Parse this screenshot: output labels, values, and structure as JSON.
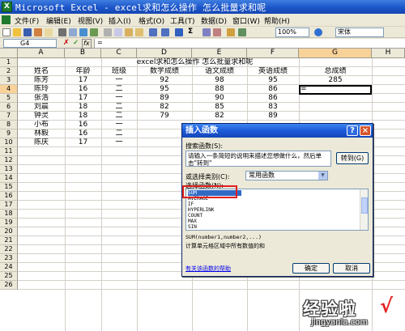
{
  "window": {
    "app_icon": "excel-icon",
    "title": "Microsoft Excel - excel求和怎么操作 怎么批量求和呢"
  },
  "menubar": {
    "items": [
      {
        "label": "文件(F)"
      },
      {
        "label": "编辑(E)"
      },
      {
        "label": "视图(V)"
      },
      {
        "label": "插入(I)"
      },
      {
        "label": "格式(O)"
      },
      {
        "label": "工具(T)"
      },
      {
        "label": "数据(D)"
      },
      {
        "label": "窗口(W)"
      },
      {
        "label": "帮助(H)"
      }
    ]
  },
  "toolbar": {
    "autosum_label": "Σ",
    "zoom": "100%",
    "font": "宋体",
    "icons": [
      "new-icon",
      "open-icon",
      "save-icon",
      "permission-icon",
      "email-icon",
      "print-icon",
      "print-preview-icon",
      "spelling-icon",
      "research-icon",
      "cut-icon",
      "copy-icon",
      "paste-icon",
      "format-painter-icon",
      "undo-icon",
      "redo-icon",
      "hyperlink-icon",
      "autosum-icon",
      "sort-asc-icon",
      "sort-desc-icon",
      "chart-icon",
      "drawing-icon",
      "help-icon"
    ]
  },
  "formula_bar": {
    "name_box": "G4",
    "cancel": "✗",
    "enter": "✓",
    "fx": "fx",
    "content": "="
  },
  "sheet": {
    "columns": [
      "A",
      "B",
      "C",
      "D",
      "E",
      "F",
      "G",
      "H"
    ],
    "rows": [
      "1",
      "2",
      "3",
      "4",
      "5",
      "6",
      "7",
      "8",
      "9",
      "10",
      "11",
      "12",
      "13",
      "14",
      "15",
      "16",
      "17",
      "18",
      "19",
      "20",
      "21",
      "22",
      "23",
      "24",
      "25",
      "26"
    ],
    "title": "excel求和怎么操作 怎么批量求和呢",
    "headers": [
      "姓名",
      "年龄",
      "班级",
      "数学成绩",
      "语文成绩",
      "英语成绩",
      "总成绩"
    ],
    "data": [
      [
        "陈芳",
        "17",
        "一",
        "92",
        "98",
        "95",
        "285"
      ],
      [
        "陈玲",
        "16",
        "二",
        "95",
        "88",
        "86",
        "="
      ],
      [
        "张浩",
        "17",
        "一",
        "89",
        "90",
        "86",
        ""
      ],
      [
        "刘晨",
        "18",
        "二",
        "82",
        "85",
        "83",
        ""
      ],
      [
        "钟灵",
        "18",
        "二",
        "79",
        "82",
        "89",
        ""
      ],
      [
        "小布",
        "16",
        "一",
        "",
        "",
        "",
        ""
      ],
      [
        "林毅",
        "16",
        "二",
        "",
        "",
        "",
        ""
      ],
      [
        "陈庆",
        "17",
        "一",
        "",
        "",
        "",
        ""
      ]
    ]
  },
  "dialog": {
    "title": "插入函数",
    "help_btn": "?",
    "close_btn": "×",
    "search_label": "搜索函数(S):",
    "search_text": "请输入一条简短的说明来描述您想做什么，然后单击\"转到\"",
    "go_button": "转到(G)",
    "category_label": "或选择类别(C):",
    "category_value": "常用函数",
    "select_label": "选择函数(N):",
    "functions": [
      "SUM",
      "AVERAGE",
      "IF",
      "HYPERLINK",
      "COUNT",
      "MAX",
      "SIN"
    ],
    "selected_function": "SUM",
    "signature": "SUM(number1,number2,...)",
    "description": "计算单元格区域中所有数值的和",
    "help_link": "有关该函数的帮助",
    "ok": "确定",
    "cancel": "取消"
  },
  "watermark": {
    "text": "经验啦",
    "check": "√",
    "url": "jingyanla.com"
  },
  "colors": {
    "titlebar": "#1c55c9",
    "dialog_title": "#1d5ad8",
    "selection": "#316ac5",
    "highlight_box": "#e02020",
    "menu_bg": "#ece9d8"
  }
}
